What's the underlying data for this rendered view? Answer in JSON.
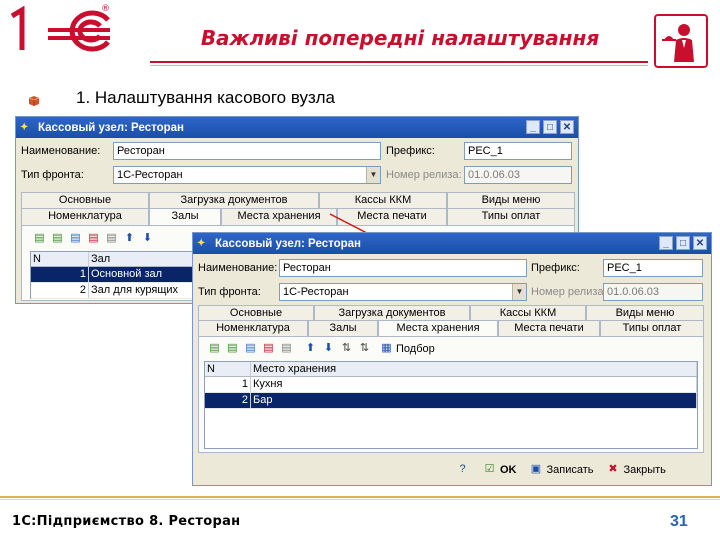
{
  "slide": {
    "title": "Важливі попередні налаштування",
    "subtitle": "1. Налаштування касового вузла",
    "footer": "1С:Підприємство 8. Ресторан",
    "page_number": "31",
    "colors": {
      "accent": "#c8102e",
      "page_number": "#2c63b0",
      "footer_line": "#e0b24a"
    }
  },
  "window_back": {
    "title": "Кассовый узел: Ресторан",
    "labels": {
      "name": "Наименование:",
      "prefix": "Префикс:",
      "front_type": "Тип фронта:",
      "release": "Номер релиза:"
    },
    "values": {
      "name": "Ресторан",
      "prefix": "РЕС_1",
      "front_type": "1С-Ресторан",
      "release": "01.0.06.03"
    },
    "tabs_row1": [
      "Основные",
      "Загрузка документов",
      "Кассы ККМ",
      "Виды меню"
    ],
    "tabs_row2": [
      "Номенклатура",
      "Залы",
      "Места хранения",
      "Места печати",
      "Типы оплат"
    ],
    "active_tab": "Залы",
    "grid": {
      "columns": [
        "N",
        "Зал"
      ],
      "rows": [
        {
          "n": "1",
          "name": "Основной зал",
          "selected": true
        },
        {
          "n": "2",
          "name": "Зал для курящих",
          "selected": false
        }
      ]
    }
  },
  "window_front": {
    "title": "Кассовый узел: Ресторан",
    "labels": {
      "name": "Наименование:",
      "prefix": "Префикс:",
      "front_type": "Тип фронта:",
      "release": "Номер релиза:"
    },
    "values": {
      "name": "Ресторан",
      "prefix": "РЕС_1",
      "front_type": "1С-Ресторан",
      "release": "01.0.06.03"
    },
    "tabs_row1": [
      "Основные",
      "Загрузка документов",
      "Кассы ККМ",
      "Виды меню"
    ],
    "tabs_row2": [
      "Номенклатура",
      "Залы",
      "Места хранения",
      "Места печати",
      "Типы оплат"
    ],
    "active_tab": "Места хранения",
    "toolbar": {
      "select_label": "Подбор"
    },
    "grid": {
      "columns": [
        "N",
        "Место хранения"
      ],
      "rows": [
        {
          "n": "1",
          "name": "Кухня",
          "selected": false
        },
        {
          "n": "2",
          "name": "Бар",
          "selected": true
        }
      ]
    },
    "buttons": {
      "ok": "OK",
      "save": "Записать",
      "close": "Закрыть"
    }
  }
}
